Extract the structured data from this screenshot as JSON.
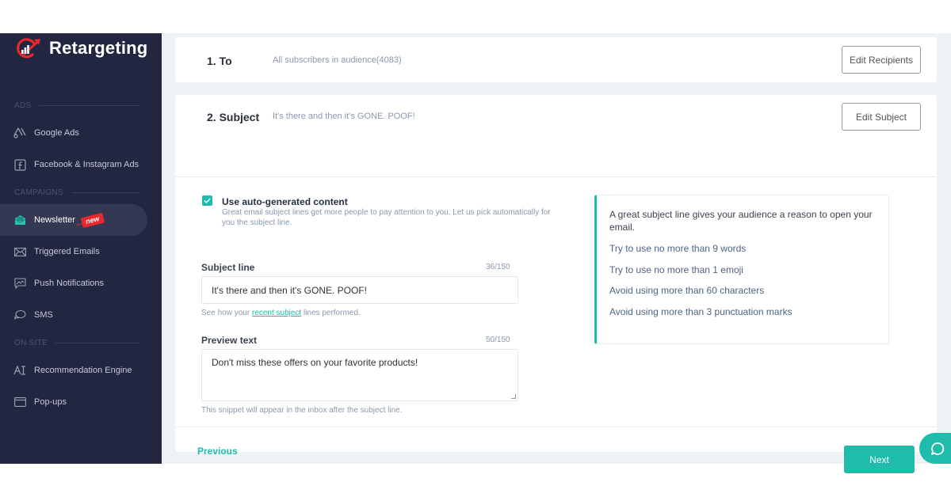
{
  "app": {
    "brand": "Retargeting",
    "accent_color": "#1fbcab",
    "sidebar_color": "#222640",
    "logo_color": "#e8282c"
  },
  "sidebar": {
    "sections": [
      {
        "label": "ADS"
      },
      {
        "label": "CAMPAIGNS"
      },
      {
        "label": "ON SITE"
      }
    ],
    "items": [
      {
        "label": "Google Ads",
        "icon": "google-ads-icon"
      },
      {
        "label": "Facebook & Instagram Ads",
        "icon": "facebook-icon"
      },
      {
        "label": "Newsletter",
        "icon": "newsletter-icon",
        "active": true,
        "badge": "new"
      },
      {
        "label": "Triggered Emails",
        "icon": "envelope-icon"
      },
      {
        "label": "Push Notifications",
        "icon": "push-notification-icon"
      },
      {
        "label": "SMS",
        "icon": "chat-bubbles-icon"
      },
      {
        "label": "Recommendation Engine",
        "icon": "ai-icon"
      },
      {
        "label": "Pop-ups",
        "icon": "popup-window-icon"
      }
    ]
  },
  "steps": {
    "to": {
      "title": "1. To",
      "description": "All subscribers in audience(4083)",
      "button": "Edit Recipients"
    },
    "subject": {
      "title": "2. Subject",
      "description": "It's there and then it's GONE. POOF!",
      "button": "Edit Subject"
    }
  },
  "form": {
    "auto_generate": {
      "checked": true,
      "title": "Use auto-generated content",
      "description": "Great email subject lines get more people to pay attention to you. Let us pick automatically for you the subject line."
    },
    "subject_line": {
      "label": "Subject line",
      "counter": "36/150",
      "value": "It's there and then it's GONE. POOF!",
      "hint_prefix": "See how your ",
      "hint_link": "recent subject",
      "hint_suffix": " lines performed."
    },
    "preview_text": {
      "label": "Preview text",
      "counter": "50/150",
      "value": "Don't miss these offers on your favorite products!",
      "hint": "This snippet will appear in the inbox after the subject line."
    }
  },
  "tips": {
    "lead": "A great subject line gives your audience a reason to open your email.",
    "items": [
      "Try to use no more than 9 words",
      "Try to use no more than 1 emoji",
      "Avoid using more than 60 characters",
      "Avoid using more than 3 punctuation marks"
    ]
  },
  "footer": {
    "previous": "Previous",
    "next": "Next"
  },
  "chat": {
    "icon": "chat-icon"
  }
}
